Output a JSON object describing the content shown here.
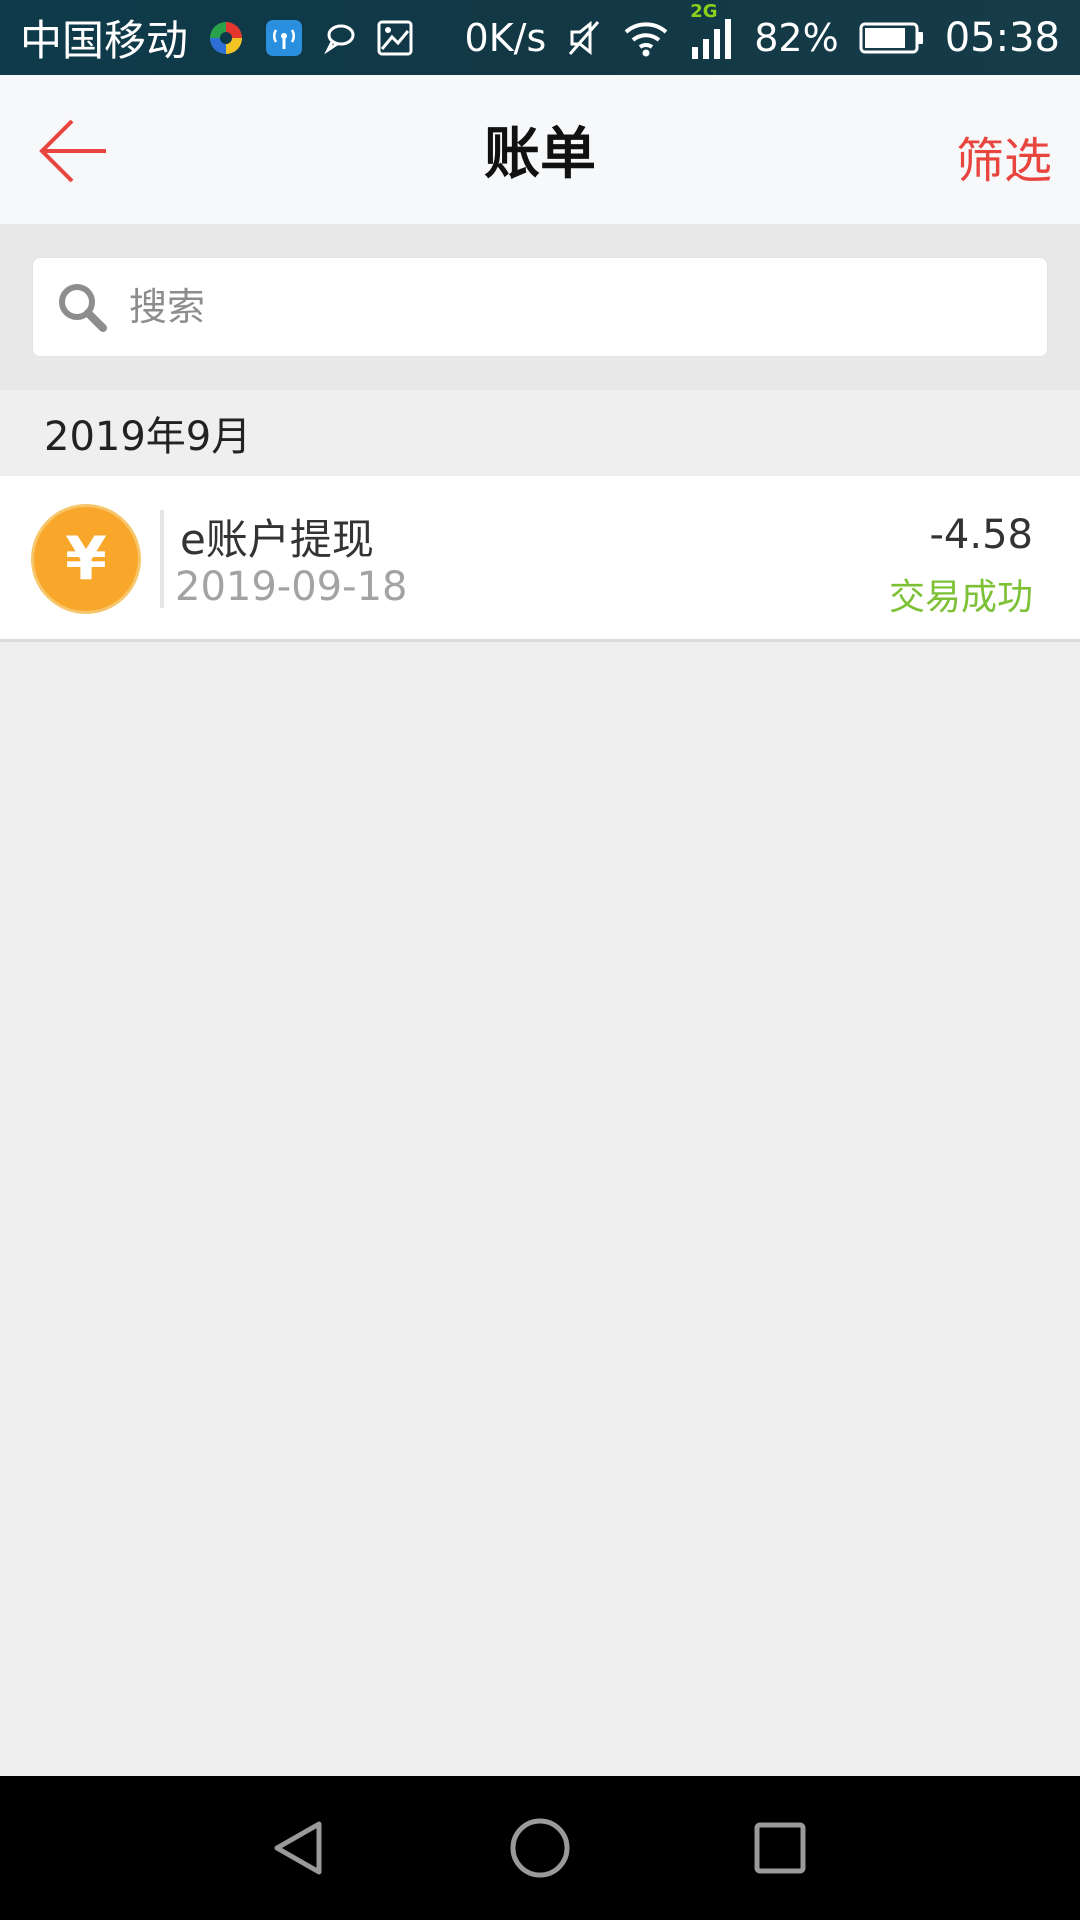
{
  "status_bar": {
    "carrier": "中国移动",
    "net_speed": "0K/s",
    "network_type": "2G",
    "battery": "82%",
    "time": "05:38"
  },
  "app_bar": {
    "title": "账单",
    "filter_label": "筛选"
  },
  "search": {
    "placeholder": "搜索",
    "value": ""
  },
  "transactions": {
    "month": "2019年9月",
    "items": [
      {
        "icon_glyph": "¥",
        "title": "e账户提现",
        "date": "2019-09-18",
        "amount": "-4.58",
        "status": "交易成功"
      }
    ]
  },
  "colors": {
    "accent_red": "#e9453f",
    "coin_orange": "#f9a72a",
    "success_green": "#7dc136"
  }
}
